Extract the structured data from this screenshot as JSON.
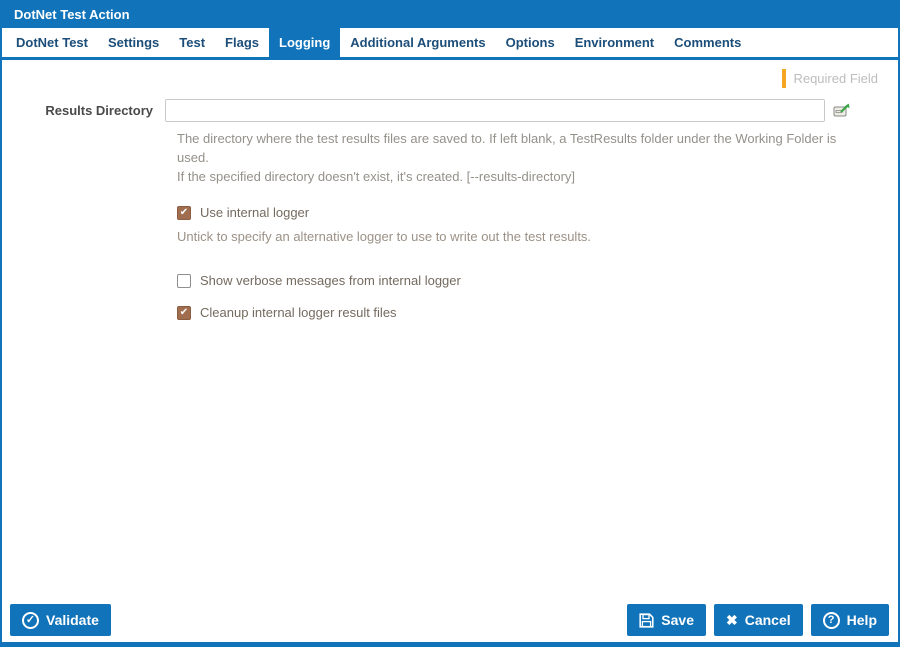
{
  "window": {
    "title": "DotNet Test Action"
  },
  "tabs": {
    "items": [
      {
        "label": "DotNet Test",
        "active": false
      },
      {
        "label": "Settings",
        "active": false
      },
      {
        "label": "Test",
        "active": false
      },
      {
        "label": "Flags",
        "active": false
      },
      {
        "label": "Logging",
        "active": true
      },
      {
        "label": "Additional Arguments",
        "active": false
      },
      {
        "label": "Options",
        "active": false
      },
      {
        "label": "Environment",
        "active": false
      },
      {
        "label": "Comments",
        "active": false
      }
    ]
  },
  "panel": {
    "required_field_label": "Required Field"
  },
  "form": {
    "results_directory": {
      "label": "Results Directory",
      "value": "",
      "help_line1": "The directory where the test results files are saved to. If left blank, a TestResults folder under the Working Folder is used.",
      "help_line2": "If the specified directory doesn't exist, it's created. [--results-directory]"
    },
    "checkboxes": [
      {
        "label": "Use internal logger",
        "checked": true,
        "hint": "Untick to specify an alternative logger to use to write out the test results."
      },
      {
        "label": "Show verbose messages from internal logger",
        "checked": false
      },
      {
        "label": "Cleanup internal logger result files",
        "checked": true
      }
    ]
  },
  "footer": {
    "validate_label": "Validate",
    "save_label": "Save",
    "cancel_label": "Cancel",
    "help_label": "Help"
  },
  "colors": {
    "primary_blue": "#1173B9",
    "required_orange": "#F5A623",
    "checkbox_checked_brown": "#A06E4E",
    "expand_arrow_green": "#3AA545"
  }
}
